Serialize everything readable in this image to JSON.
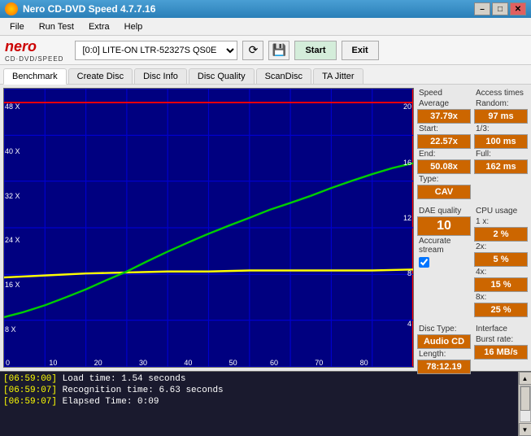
{
  "app": {
    "title": "Nero CD-DVD Speed 4.7.7.16",
    "icon": "disc-icon"
  },
  "titlebar": {
    "minimize": "–",
    "maximize": "□",
    "close": "✕"
  },
  "menu": {
    "items": [
      "File",
      "Run Test",
      "Extra",
      "Help"
    ]
  },
  "toolbar": {
    "logo_nero": "nero",
    "logo_sub": "CD·DVD/SPEED",
    "drive_label": "[0:0]  LITE-ON LTR-52327S QS0E",
    "start_label": "Start",
    "exit_label": "Exit"
  },
  "tabs": [
    {
      "id": "benchmark",
      "label": "Benchmark",
      "active": true
    },
    {
      "id": "create-disc",
      "label": "Create Disc",
      "active": false
    },
    {
      "id": "disc-info",
      "label": "Disc Info",
      "active": false
    },
    {
      "id": "disc-quality",
      "label": "Disc Quality",
      "active": false
    },
    {
      "id": "scandisc",
      "label": "ScanDisc",
      "active": false
    },
    {
      "id": "ta-jitter",
      "label": "TA Jitter",
      "active": false
    }
  ],
  "chart": {
    "x_labels": [
      "0",
      "10",
      "20",
      "30",
      "40",
      "50",
      "60",
      "70",
      "80"
    ],
    "y_left_labels": [
      "8 X",
      "16 X",
      "24 X",
      "32 X",
      "40 X",
      "48 X"
    ],
    "y_right_labels": [
      "4",
      "8",
      "12",
      "16",
      "20"
    ]
  },
  "stats": {
    "speed_label": "Speed",
    "avg_label": "Average",
    "avg_value": "37.79x",
    "start_label": "Start:",
    "start_value": "22.57x",
    "end_label": "End:",
    "end_value": "50.08x",
    "type_label": "Type:",
    "type_value": "CAV",
    "dae_label": "DAE quality",
    "dae_value": "10",
    "accurate_label": "Accurate stream",
    "accurate_checked": true,
    "disc_label": "Disc Type:",
    "disc_value": "Audio CD",
    "length_label": "Length:",
    "length_value": "78:12.19",
    "access_label": "Access times",
    "random_label": "Random:",
    "random_value": "97 ms",
    "one_third_label": "1/3:",
    "one_third_value": "100 ms",
    "full_label": "Full:",
    "full_value": "162 ms",
    "cpu_label": "CPU usage",
    "cpu_1x_label": "1 x:",
    "cpu_1x_value": "2 %",
    "cpu_2x_label": "2x:",
    "cpu_2x_value": "5 %",
    "cpu_4x_label": "4x:",
    "cpu_4x_value": "15 %",
    "cpu_8x_label": "8x:",
    "cpu_8x_value": "25 %",
    "interface_label": "Interface",
    "burst_label": "Burst rate:",
    "burst_value": "16 MB/s"
  },
  "log": {
    "lines": [
      {
        "time": "[06:59:00]",
        "text": " Load time: 1.54 seconds"
      },
      {
        "time": "[06:59:07]",
        "text": " Recognition time: 6.63 seconds"
      },
      {
        "time": "[06:59:07]",
        "text": " Elapsed Time: 0:09"
      }
    ]
  }
}
